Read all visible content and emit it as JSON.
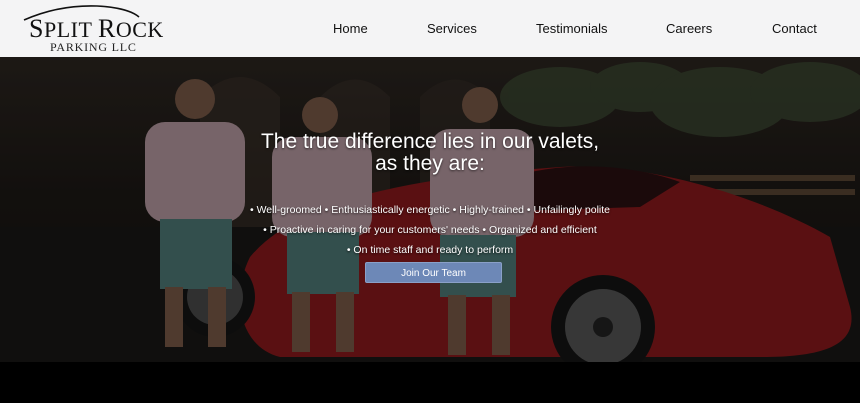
{
  "logo": {
    "title_initial_1": "S",
    "title_rest_1": "PLIT ",
    "title_initial_2": "R",
    "title_rest_2": "OCK",
    "subtitle": "PARKING LLC"
  },
  "nav": {
    "items": [
      {
        "label": "Home"
      },
      {
        "label": "Services"
      },
      {
        "label": "Testimonials"
      },
      {
        "label": "Careers"
      },
      {
        "label": "Contact"
      }
    ]
  },
  "hero": {
    "headline_line1": "The true difference lies in our valets,",
    "headline_line2": "as they are:",
    "features_line1": "• Well-groomed • Enthusiastically energetic • Highly-trained • Unfailingly polite",
    "features_line2": "• Proactive in caring for your customers' needs • Organized and efficient",
    "features_line3": "• On time staff and ready to perform",
    "cta_label": "Join Our Team",
    "cta_color": "#6d88b7"
  }
}
